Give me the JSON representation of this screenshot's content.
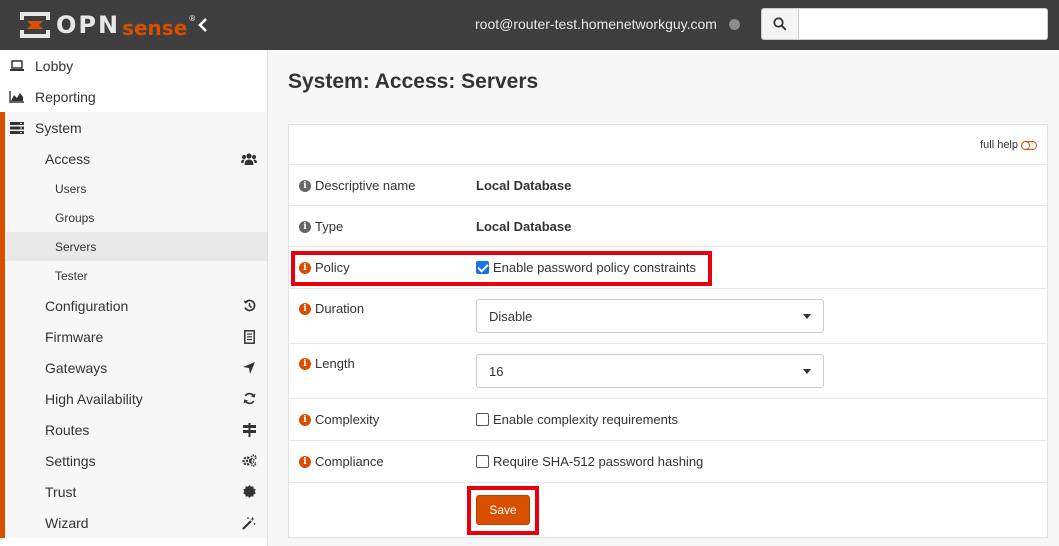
{
  "brand": {
    "logo_main": "OPN",
    "logo_sense": "sense",
    "logo_reg": "®"
  },
  "header": {
    "user": "root@router-test.homenetworkguy.com",
    "search_placeholder": ""
  },
  "sidebar": {
    "top_items": [
      {
        "label": "Lobby",
        "icon": "laptop-icon"
      },
      {
        "label": "Reporting",
        "icon": "area-chart-icon"
      }
    ],
    "system_label": "System",
    "access_label": "Access",
    "access_children": [
      "Users",
      "Groups",
      "Servers",
      "Tester"
    ],
    "active_child": "Servers",
    "system_items": [
      {
        "label": "Configuration",
        "icon": "history-icon"
      },
      {
        "label": "Firmware",
        "icon": "document-icon"
      },
      {
        "label": "Gateways",
        "icon": "location-arrow-icon"
      },
      {
        "label": "High Availability",
        "icon": "refresh-icon"
      },
      {
        "label": "Routes",
        "icon": "signpost-icon"
      },
      {
        "label": "Settings",
        "icon": "cogs-icon"
      },
      {
        "label": "Trust",
        "icon": "certificate-icon"
      },
      {
        "label": "Wizard",
        "icon": "magic-icon"
      }
    ]
  },
  "main": {
    "title": "System: Access: Servers",
    "full_help": "full help",
    "fields": {
      "descriptive_name": {
        "label": "Descriptive name",
        "value": "Local Database"
      },
      "type": {
        "label": "Type",
        "value": "Local Database"
      },
      "policy": {
        "label": "Policy",
        "checkbox_label": "Enable password policy constraints",
        "checked": true
      },
      "duration": {
        "label": "Duration",
        "value": "Disable"
      },
      "length": {
        "label": "Length",
        "value": "16"
      },
      "complexity": {
        "label": "Complexity",
        "checkbox_label": "Enable complexity requirements",
        "checked": false
      },
      "compliance": {
        "label": "Compliance",
        "checkbox_label": "Require SHA-512 password hashing",
        "checked": false
      }
    },
    "save_label": "Save"
  },
  "colors": {
    "accent": "#d94f00",
    "highlight": "#e8000e",
    "topbar": "#3e3e3e"
  }
}
